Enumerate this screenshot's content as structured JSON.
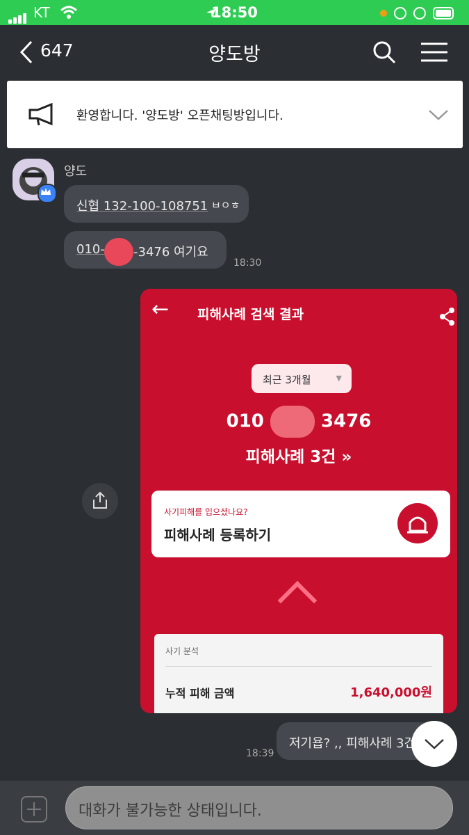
{
  "status": {
    "carrier": "KT",
    "time": "18:50"
  },
  "header": {
    "back_count": "647",
    "title": "양도방"
  },
  "notice": {
    "text": "환영합니다. '양도방' 오픈채팅방입니다."
  },
  "messages": [
    {
      "sender": "양도",
      "bubbles": [
        "신협 132-100-108751",
        "ㅂㅇㅎ"
      ]
    },
    {
      "bubble2_prefix": "010-",
      "bubble2_suffix": "-3476 여기요",
      "time": "18:30"
    }
  ],
  "photo": {
    "title": "피해사례 검색 결과",
    "period": "최근 3개월",
    "phone_prefix": "010",
    "phone_suffix": "3476",
    "cases": "피해사례 3건",
    "card_question": "사기피해를 입으셨나요?",
    "card_action": "피해사례 등록하기",
    "panel_sub": "사기 분석",
    "panel_label": "누적 피해 금액",
    "panel_value": "1,640,000원"
  },
  "my_message": {
    "text": "저기욥? ,, 피해사례 3건",
    "time": "18:39"
  },
  "input": {
    "placeholder": "대화가 불가능한 상태입니다."
  }
}
